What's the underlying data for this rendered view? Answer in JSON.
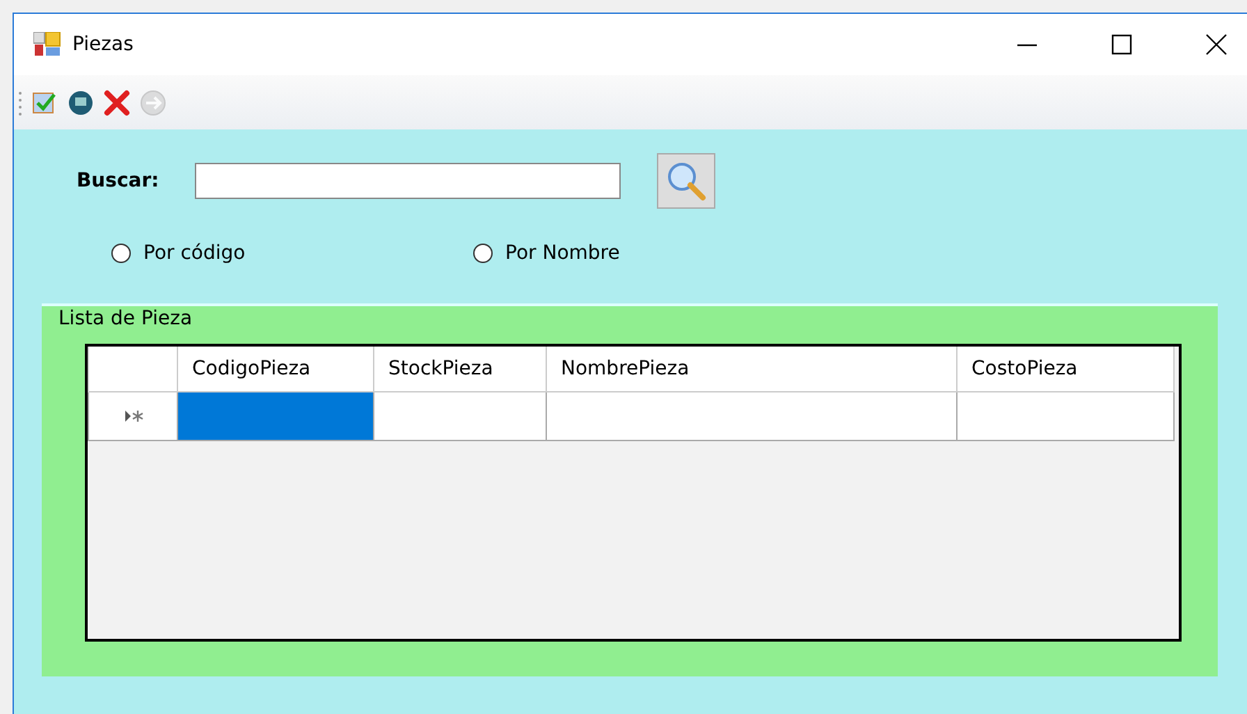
{
  "window": {
    "title": "Piezas"
  },
  "toolbar": [
    {
      "kind": "edit"
    },
    {
      "kind": "save"
    },
    {
      "kind": "delete"
    },
    {
      "kind": "go",
      "disabled": true
    }
  ],
  "search": {
    "label": "Buscar:"
  },
  "options": [
    {
      "label": "Por código",
      "checked": false
    },
    {
      "label": "Por Nombre",
      "checked": false
    }
  ],
  "group": {
    "title": "Lista de Pieza",
    "table": {
      "columns": [
        "CodigoPieza",
        "StockPieza",
        "NombrePieza",
        "CostoPieza"
      ],
      "rows": [
        {
          "kind": "new",
          "cells": [
            {
              "selected": true
            },
            {
              "selected": false
            },
            {
              "selected": false
            },
            {
              "selected": false
            }
          ]
        }
      ]
    }
  }
}
